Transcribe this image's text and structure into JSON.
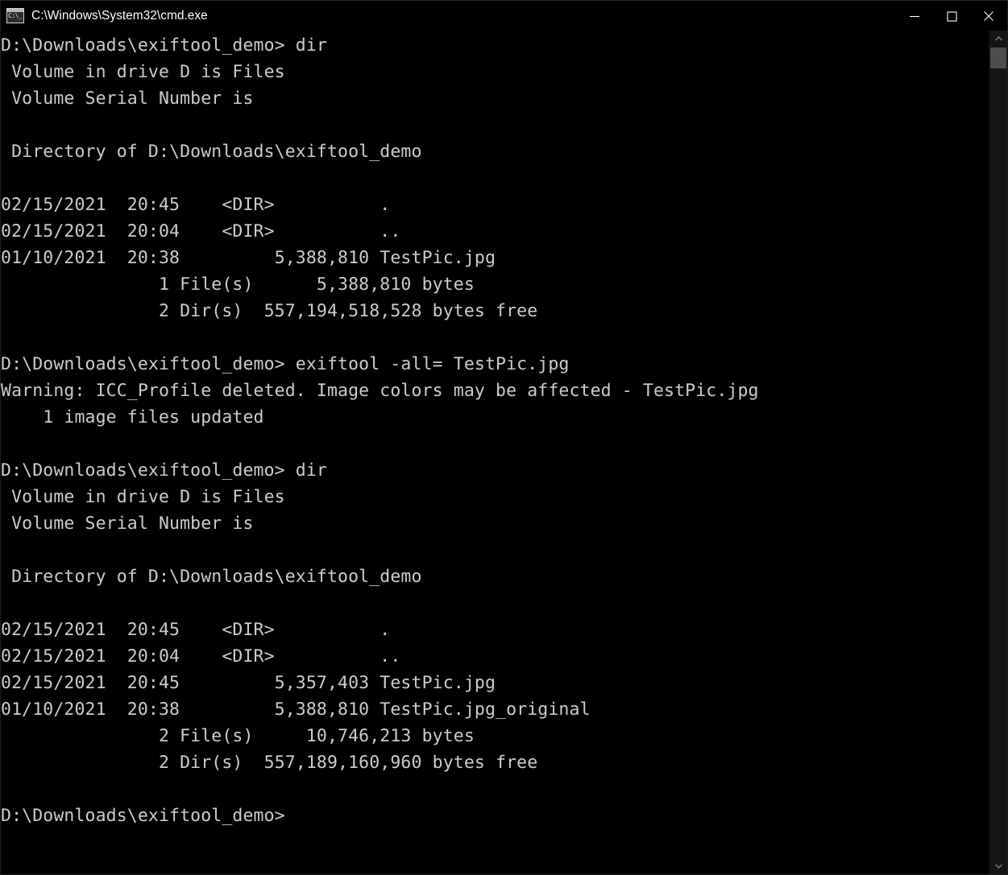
{
  "window": {
    "title": "C:\\Windows\\System32\\cmd.exe",
    "icon_text": "C:\\_",
    "icon_name": "cmd-icon",
    "background_color": "#000000",
    "text_color": "#cccccc",
    "controls": {
      "minimize_label": "Minimize",
      "maximize_label": "Maximize",
      "close_label": "Close"
    }
  },
  "scrollbar": {
    "up_label": "Scroll up",
    "down_label": "Scroll down",
    "thumb_label": "Scroll thumb"
  },
  "console": {
    "prompt": "D:\\Downloads\\exiftool_demo>",
    "lines": [
      "D:\\Downloads\\exiftool_demo> dir",
      " Volume in drive D is Files",
      " Volume Serial Number is",
      "",
      " Directory of D:\\Downloads\\exiftool_demo",
      "",
      "02/15/2021  20:45    <DIR>          .",
      "02/15/2021  20:04    <DIR>          ..",
      "01/10/2021  20:38         5,388,810 TestPic.jpg",
      "               1 File(s)      5,388,810 bytes",
      "               2 Dir(s)  557,194,518,528 bytes free",
      "",
      "D:\\Downloads\\exiftool_demo> exiftool -all= TestPic.jpg",
      "Warning: ICC_Profile deleted. Image colors may be affected - TestPic.jpg",
      "    1 image files updated",
      "",
      "D:\\Downloads\\exiftool_demo> dir",
      " Volume in drive D is Files",
      " Volume Serial Number is",
      "",
      " Directory of D:\\Downloads\\exiftool_demo",
      "",
      "02/15/2021  20:45    <DIR>          .",
      "02/15/2021  20:04    <DIR>          ..",
      "02/15/2021  20:45         5,357,403 TestPic.jpg",
      "01/10/2021  20:38         5,388,810 TestPic.jpg_original",
      "               2 File(s)     10,746,213 bytes",
      "               2 Dir(s)  557,189,160,960 bytes free",
      "",
      "D:\\Downloads\\exiftool_demo>"
    ],
    "commands": [
      "dir",
      "exiftool -all= TestPic.jpg",
      "dir"
    ],
    "volume_label": "Files",
    "directory": "D:\\Downloads\\exiftool_demo",
    "listing_before": {
      "entries": [
        {
          "date": "02/15/2021",
          "time": "20:45",
          "kind": "<DIR>",
          "size": "",
          "name": "."
        },
        {
          "date": "02/15/2021",
          "time": "20:04",
          "kind": "<DIR>",
          "size": "",
          "name": ".."
        },
        {
          "date": "01/10/2021",
          "time": "20:38",
          "kind": "",
          "size": "5,388,810",
          "name": "TestPic.jpg"
        }
      ],
      "file_count": "1 File(s)",
      "file_bytes": "5,388,810 bytes",
      "dir_count": "2 Dir(s)",
      "free_bytes": "557,194,518,528 bytes free"
    },
    "listing_after": {
      "entries": [
        {
          "date": "02/15/2021",
          "time": "20:45",
          "kind": "<DIR>",
          "size": "",
          "name": "."
        },
        {
          "date": "02/15/2021",
          "time": "20:04",
          "kind": "<DIR>",
          "size": "",
          "name": ".."
        },
        {
          "date": "02/15/2021",
          "time": "20:45",
          "kind": "",
          "size": "5,357,403",
          "name": "TestPic.jpg"
        },
        {
          "date": "01/10/2021",
          "time": "20:38",
          "kind": "",
          "size": "5,388,810",
          "name": "TestPic.jpg_original"
        }
      ],
      "file_count": "2 File(s)",
      "file_bytes": "10,746,213 bytes",
      "dir_count": "2 Dir(s)",
      "free_bytes": "557,189,160,960 bytes free"
    },
    "warning": "Warning: ICC_Profile deleted. Image colors may be affected - TestPic.jpg",
    "result": "    1 image files updated"
  }
}
